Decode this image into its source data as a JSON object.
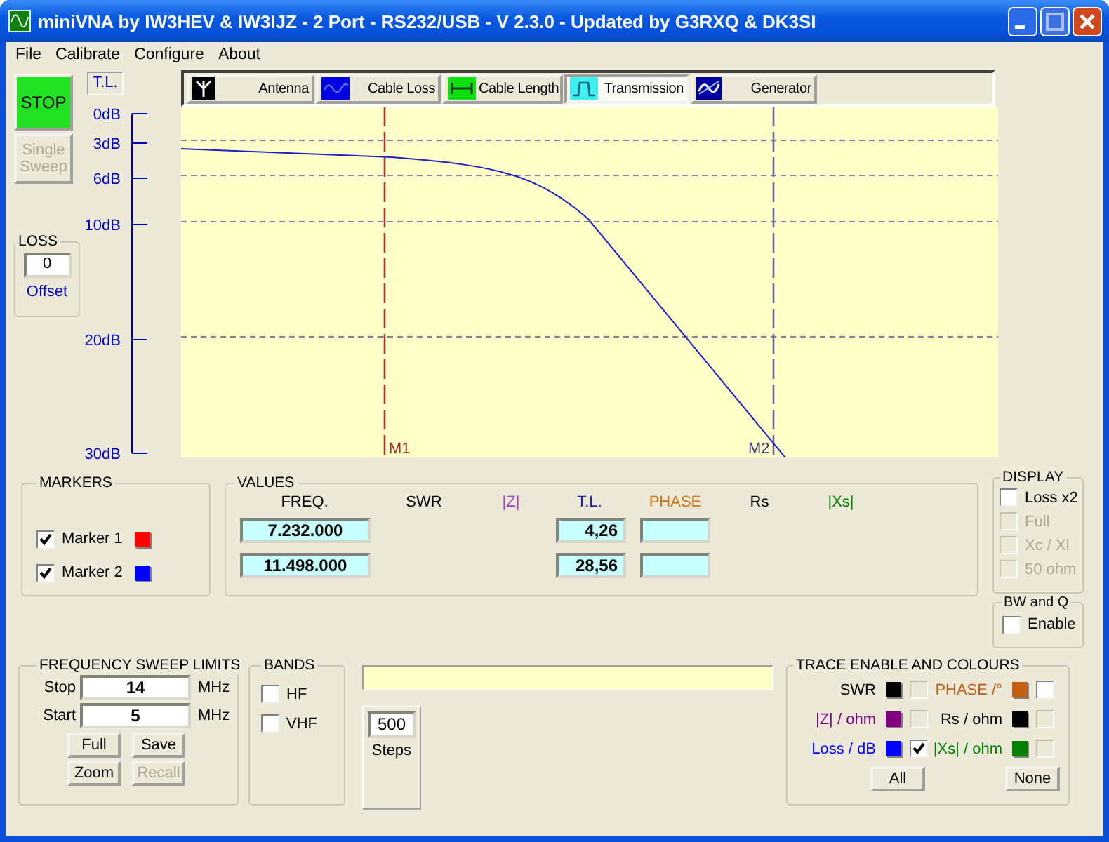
{
  "window": {
    "title": "miniVNA by IW3HEV & IW3IJZ - 2 Port - RS232/USB - V 2.3.0 - Updated by G3RXQ & DK3SI"
  },
  "menu": [
    "File",
    "Calibrate",
    "Configure",
    "About"
  ],
  "stop_button": {
    "label": "STOP"
  },
  "sweep_button": {
    "label": "Single Sweep",
    "disabled": true
  },
  "axis": {
    "label": "T.L.",
    "ticks": [
      "0dB",
      "3dB",
      "6dB",
      "10dB",
      "20dB",
      "30dB"
    ]
  },
  "loss": {
    "title": "LOSS",
    "value": "0",
    "caption": "Offset"
  },
  "tabs": [
    {
      "label": "Antenna",
      "kind": "antenna",
      "selected": false
    },
    {
      "label": "Cable Loss",
      "kind": "wave",
      "selected": false
    },
    {
      "label": "Cable Length",
      "kind": "length",
      "selected": false
    },
    {
      "label": "Transmission",
      "kind": "pulse",
      "selected": true
    },
    {
      "label": "Generator",
      "kind": "generator",
      "selected": false
    }
  ],
  "chart": {
    "marker_labels": [
      "M1",
      "M2"
    ]
  },
  "markers": {
    "title": "MARKERS",
    "items": [
      {
        "label": "Marker 1",
        "checked": true,
        "color": "#ff0000"
      },
      {
        "label": "Marker 2",
        "checked": true,
        "color": "#0000ff"
      }
    ]
  },
  "values": {
    "title": "VALUES",
    "columns": [
      {
        "label": "FREQ.",
        "color": "#000000"
      },
      {
        "label": "SWR",
        "color": "#000000"
      },
      {
        "label": "|Z|",
        "color": "#a040c0"
      },
      {
        "label": "T.L.",
        "color": "#2020c0"
      },
      {
        "label": "PHASE",
        "color": "#d07010"
      },
      {
        "label": "Rs",
        "color": "#000000"
      },
      {
        "label": "|Xs|",
        "color": "#008000"
      }
    ],
    "rows": [
      {
        "freq": "7.232.000",
        "tl": "4,26"
      },
      {
        "freq": "11.498.000",
        "tl": "28,56"
      }
    ]
  },
  "display": {
    "title": "DISPLAY",
    "options": [
      {
        "label": "Loss x2",
        "checked": false,
        "disabled": false
      },
      {
        "label": "Full",
        "checked": false,
        "disabled": true
      },
      {
        "label": "Xc / Xl",
        "checked": false,
        "disabled": true
      },
      {
        "label": "50 ohm",
        "checked": false,
        "disabled": true
      }
    ]
  },
  "bw": {
    "title": "BW and Q",
    "options": [
      {
        "label": "Enable",
        "checked": false,
        "disabled": false
      }
    ]
  },
  "sweep": {
    "title": "FREQUENCY SWEEP LIMITS",
    "fields": [
      {
        "label": "Stop",
        "value": "14",
        "unit": "MHz"
      },
      {
        "label": "Start",
        "value": "5",
        "unit": "MHz"
      }
    ],
    "buttons": [
      {
        "label": "Full",
        "disabled": false
      },
      {
        "label": "Save",
        "disabled": false
      },
      {
        "label": "Zoom",
        "disabled": false
      },
      {
        "label": "Recall",
        "disabled": true
      }
    ]
  },
  "bands": {
    "title": "BANDS",
    "options": [
      {
        "label": "HF",
        "checked": false,
        "disabled": false
      },
      {
        "label": "VHF",
        "checked": false,
        "disabled": false
      }
    ]
  },
  "steps": {
    "value": "500",
    "caption": "Steps"
  },
  "traces": {
    "title": "TRACE ENABLE AND COLOURS",
    "items": [
      {
        "label": "SWR",
        "color": "#000000",
        "checked": false,
        "disabled": true
      },
      {
        "label": "PHASE /°",
        "color": "#c06010",
        "checked": false,
        "disabled": false
      },
      {
        "label": "|Z| / ohm",
        "color": "#800080",
        "checked": false,
        "disabled": true
      },
      {
        "label": "Rs / ohm",
        "color": "#000000",
        "checked": false,
        "disabled": true
      },
      {
        "label": "Loss / dB",
        "color": "#0000ff",
        "checked": true,
        "disabled": false
      },
      {
        "label": "|Xs| / ohm",
        "color": "#008000",
        "checked": false,
        "disabled": true
      }
    ],
    "buttons": [
      "All",
      "None"
    ]
  }
}
